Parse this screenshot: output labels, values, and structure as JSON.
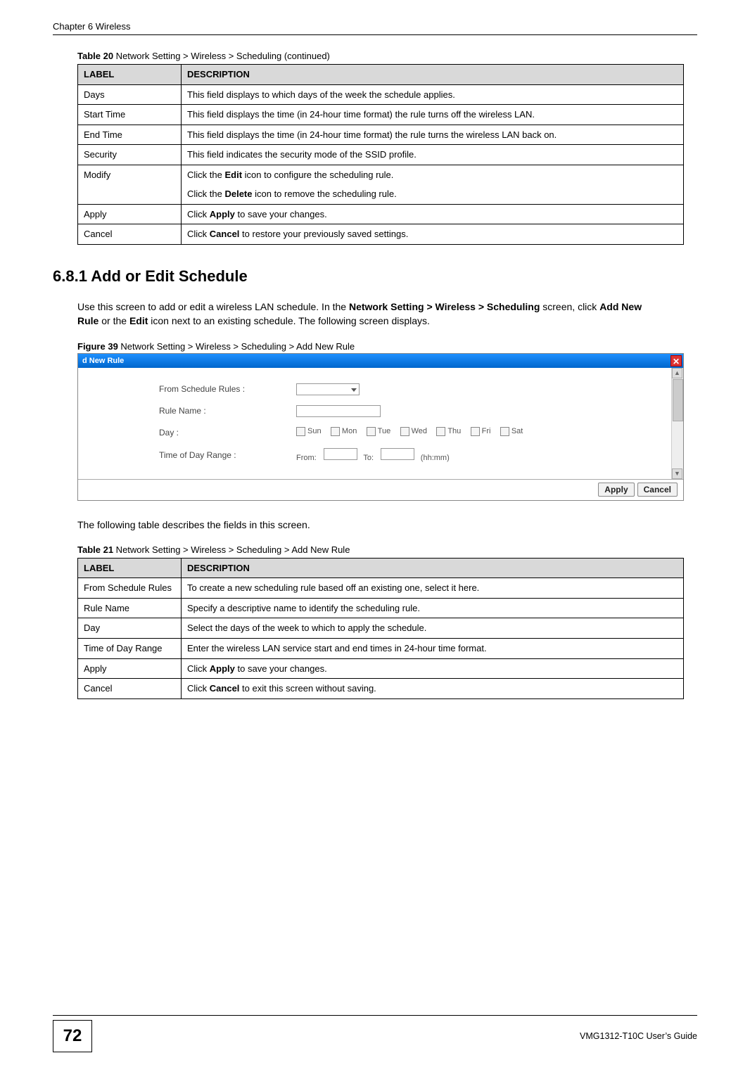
{
  "running_head": "Chapter 6 Wireless",
  "table20": {
    "caption_prefix": "Table 20",
    "caption_rest": "   Network Setting > Wireless > Scheduling (continued)",
    "headers": {
      "label": "LABEL",
      "desc": "DESCRIPTION"
    },
    "rows": [
      {
        "label": "Days",
        "desc": "This field displays to which days of the week the schedule applies."
      },
      {
        "label": "Start Time",
        "desc": "This field displays the time (in 24-hour time format) the rule turns off the wireless LAN."
      },
      {
        "label": "End Time",
        "desc": "This field displays the time (in 24-hour time format) the rule turns the wireless LAN back on."
      },
      {
        "label": "Security",
        "desc": "This field indicates the security mode of the SSID profile."
      },
      {
        "label": "Modify",
        "desc_p1_pre": "Click the ",
        "desc_p1_b": "Edit",
        "desc_p1_post": " icon to configure the scheduling rule.",
        "desc_p2_pre": "Click the ",
        "desc_p2_b": "Delete",
        "desc_p2_post": " icon to remove the scheduling rule."
      },
      {
        "label": "Apply",
        "desc_pre": "Click ",
        "desc_b": "Apply",
        "desc_post": " to save your changes."
      },
      {
        "label": "Cancel",
        "desc_pre": "Click ",
        "desc_b": "Cancel",
        "desc_post": " to restore your previously saved settings."
      }
    ]
  },
  "section": {
    "heading": "6.8.1  Add or Edit Schedule",
    "para_pre": "Use this screen to add or edit a wireless LAN schedule. In the ",
    "para_b1": "Network Setting > Wireless > Scheduling",
    "para_mid1": " screen, click ",
    "para_b2": "Add New Rule",
    "para_mid2": " or the ",
    "para_b3": "Edit",
    "para_post": " icon next to an existing schedule. The following screen displays."
  },
  "figure39": {
    "caption_prefix": "Figure 39",
    "caption_rest": "   Network Setting > Wireless > Scheduling > Add New Rule",
    "title_bar": "d New Rule",
    "labels": {
      "from_rules": "From Schedule Rules :",
      "rule_name": "Rule Name :",
      "day": "Day :",
      "time_range": "Time of Day Range :",
      "from": "From:",
      "to": "To:",
      "hhmm": "(hh:mm)"
    },
    "days": [
      "Sun",
      "Mon",
      "Tue",
      "Wed",
      "Thu",
      "Fri",
      "Sat"
    ],
    "buttons": {
      "apply": "Apply",
      "cancel": "Cancel"
    }
  },
  "para2": "The following table describes the fields in this screen.",
  "table21": {
    "caption_prefix": "Table 21",
    "caption_rest": "   Network Setting > Wireless > Scheduling > Add New Rule",
    "headers": {
      "label": "LABEL",
      "desc": "DESCRIPTION"
    },
    "rows": [
      {
        "label": "From Schedule Rules",
        "desc": "To create a new scheduling rule based off an existing one, select it here."
      },
      {
        "label": "Rule Name",
        "desc": "Specify a descriptive name to identify the scheduling rule."
      },
      {
        "label": "Day",
        "desc": "Select the days of the week to which to apply the schedule."
      },
      {
        "label": "Time of Day Range",
        "desc": "Enter the wireless LAN service start and end times in 24-hour time format."
      },
      {
        "label": "Apply",
        "desc_pre": "Click ",
        "desc_b": "Apply",
        "desc_post": " to save your changes."
      },
      {
        "label": "Cancel",
        "desc_pre": "Click ",
        "desc_b": "Cancel",
        "desc_post": " to exit this screen without saving."
      }
    ]
  },
  "footer": {
    "page_num": "72",
    "guide": "VMG1312-T10C User’s Guide"
  }
}
